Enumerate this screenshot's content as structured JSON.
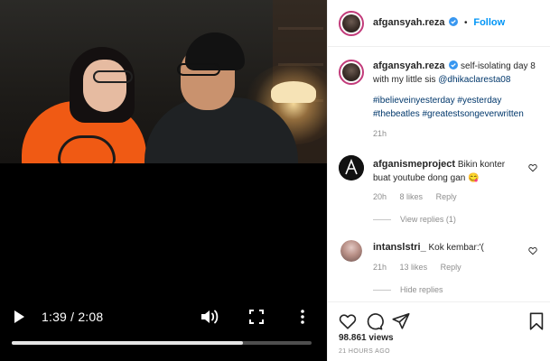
{
  "video": {
    "time": "1:39 / 2:08",
    "progress_fraction": 0.77,
    "icons": [
      "play-icon",
      "volume-icon",
      "fullscreen-icon",
      "more-vertical-icon"
    ]
  },
  "header": {
    "username": "afgansyah.reza",
    "separator": "•",
    "follow_label": "Follow"
  },
  "caption": {
    "username": "afgansyah.reza",
    "text_line": "self-isolating day 8 with my little sis",
    "mention": "@dhikaclaresta08",
    "hashtags": [
      "#ibelieveinyesterday",
      "#yesterday",
      "#thebeatles",
      "#greatestsongeverwritten"
    ],
    "time": "21h"
  },
  "comments": [
    {
      "username": "afganismeproject",
      "text": "Bikin konter buat youtube dong gan",
      "emoji": "😋",
      "time": "20h",
      "likes": "8 likes",
      "reply": "Reply",
      "view_replies": "View replies (1)"
    },
    {
      "username": "intanslstri_",
      "text": "Kok kembar:'(",
      "time": "21h",
      "likes": "13 likes",
      "reply": "Reply",
      "view_replies": "Hide replies"
    }
  ],
  "footer": {
    "views": "98.861 views",
    "time_ago": "21 HOURS AGO"
  },
  "colors": {
    "accent": "#0095f6",
    "hashtag": "#00376b",
    "muted": "#8e8e8e",
    "story_ring": "#c23b7a"
  }
}
